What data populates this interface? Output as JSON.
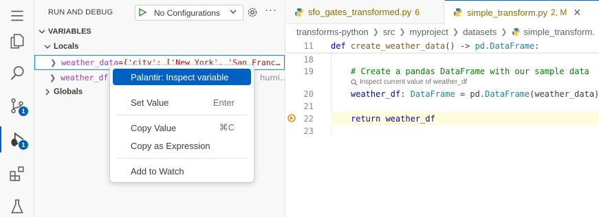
{
  "activity_bar": {
    "items": [
      {
        "name": "menu",
        "badge": ""
      },
      {
        "name": "explorer",
        "badge": ""
      },
      {
        "name": "search",
        "badge": ""
      },
      {
        "name": "source-control",
        "badge": "1"
      },
      {
        "name": "run-and-debug",
        "badge": "1"
      },
      {
        "name": "extensions",
        "badge": ""
      },
      {
        "name": "testing",
        "badge": ""
      }
    ]
  },
  "sidebar": {
    "title": "RUN AND DEBUG",
    "config_select": "No Configurations",
    "section_variables": "VARIABLES",
    "group_locals": "Locals",
    "group_globals": "Globals",
    "vars": [
      {
        "name": "weather_data",
        "eq": " = ",
        "value": "{'city': ['New York', 'San Franc…"
      },
      {
        "name": "weather_df",
        "eq": "",
        "value": "",
        "extra": "humi…"
      }
    ]
  },
  "context_menu": {
    "items": [
      {
        "label": "Palantir: Inspect variable",
        "shortcut": "",
        "highlighted": true
      },
      {
        "label": "Set Value",
        "shortcut": "Enter"
      },
      {
        "label": "Copy Value",
        "shortcut": "⌘C"
      },
      {
        "label": "Copy as Expression",
        "shortcut": ""
      },
      {
        "label": "Add to Watch",
        "shortcut": ""
      }
    ]
  },
  "editor": {
    "tabs": [
      {
        "name": "sfo_gates_transformed.py",
        "marker": "6"
      },
      {
        "name": "simple_transform.py",
        "marker": "2, M"
      }
    ],
    "breadcrumbs": [
      "transforms-python",
      "src",
      "myproject",
      "datasets",
      "simple_transform."
    ],
    "sticky": {
      "line": "11",
      "kw": "def",
      "fn": "create_weather_data",
      "rest1": "() -> ",
      "ty": "pd.DataFrame",
      "rest2": ":"
    },
    "lines": [
      {
        "num": "18"
      },
      {
        "num": "19",
        "comment": "# Create a pandas DataFrame with our sample data"
      },
      {
        "num": "20",
        "var": "weather_df",
        "sep": ": ",
        "type": "DataFrame",
        "eq": " = pd.",
        "call": "DataFrame",
        "args": "(weather_data)"
      },
      {
        "num": "21"
      },
      {
        "num": "22",
        "kw": "return",
        "var": " weather_df"
      },
      {
        "num": "23"
      }
    ],
    "inlay_hint": "Inspect current value of weather_df"
  },
  "colors": {
    "accent": "#005fb8",
    "menu_highlight": "#0060c0",
    "current_line": "#fffbdd"
  }
}
